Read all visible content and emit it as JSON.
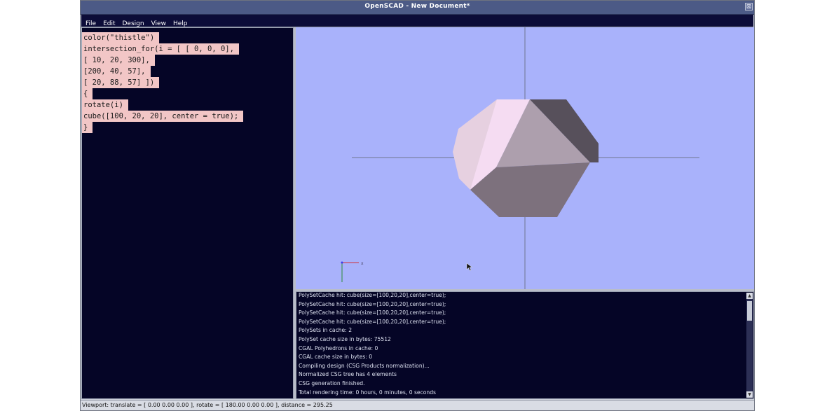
{
  "window": {
    "title": "OpenSCAD - New Document*",
    "close_glyph": "⊠"
  },
  "menu": [
    "File",
    "Edit",
    "Design",
    "View",
    "Help"
  ],
  "editor": {
    "lines": [
      "color(\"thistle\")",
      "intersection_for(i = [ [ 0, 0, 0],",
      "[ 10, 20, 300],",
      "[200, 40, 57],",
      "[ 20, 88, 57] ])",
      "{",
      "rotate(i)",
      "cube([100, 20, 20], center = true);",
      "}"
    ],
    "highlight_color": "#f2c6c6"
  },
  "viewport": {
    "background": "#a9b2fb",
    "axis_label_x": "x",
    "shape_colors": {
      "left_light": "#f5dcf2",
      "left_edge": "#e6d0e0",
      "top": "#ad9fad",
      "right_dark": "#57505b",
      "bottom": "#7d717d"
    }
  },
  "console": {
    "lines": [
      "PolySetCache hit: cube(size=[100,20,20],center=true);",
      "PolySetCache hit: cube(size=[100,20,20],center=true);",
      "PolySetCache hit: cube(size=[100,20,20],center=true);",
      "PolySetCache hit: cube(size=[100,20,20],center=true);",
      "PolySets in cache: 2",
      "PolySet cache size in bytes: 75512",
      "CGAL Polyhedrons in cache: 0",
      "CGAL cache size in bytes: 0",
      "Compiling design (CSG Products normalization)...",
      "Normalized CSG tree has 4 elements",
      "CSG generation finished.",
      "Total rendering time: 0 hours, 0 minutes, 0 seconds"
    ]
  },
  "statusbar": {
    "text": "Viewport: translate = [ 0.00 0.00 0.00 ], rotate = [ 180.00 0.00 0.00 ], distance = 295.25"
  }
}
